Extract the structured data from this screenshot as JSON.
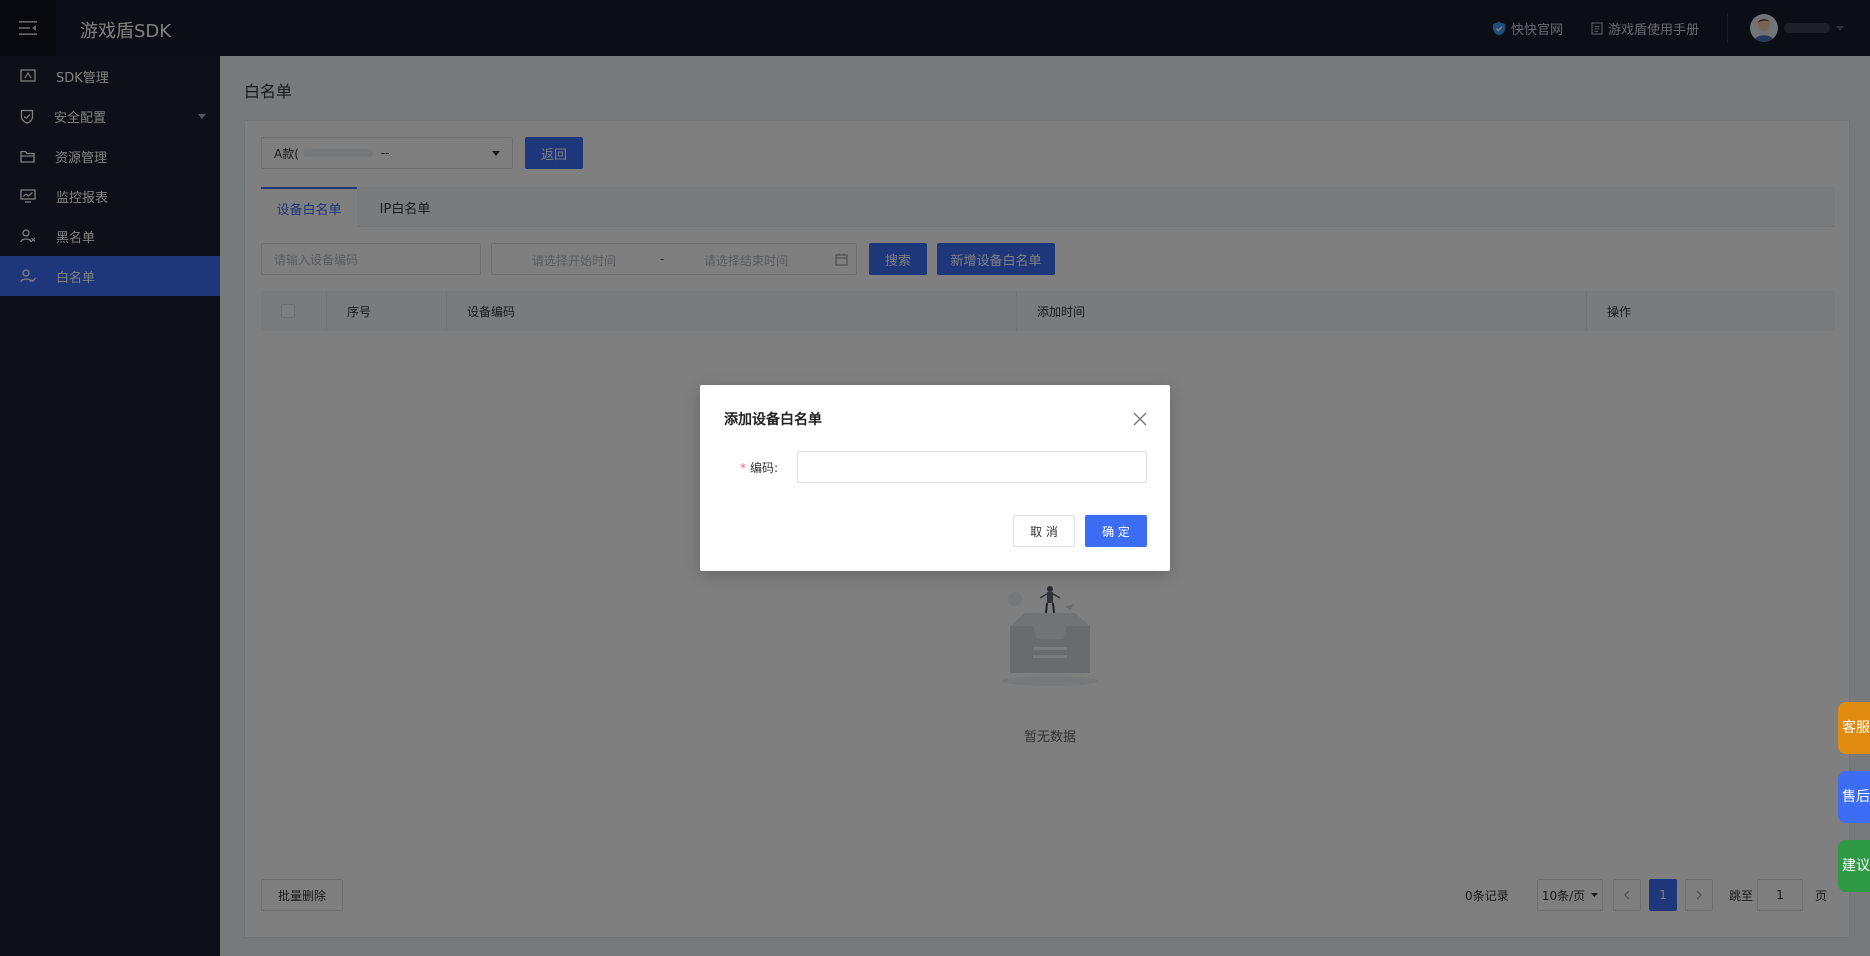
{
  "app": {
    "brand": "游戏盾SDK"
  },
  "topbar": {
    "link_official": "快快官网",
    "link_manual": "游戏盾使用手册"
  },
  "sidebar": {
    "items": [
      {
        "label": "SDK管理"
      },
      {
        "label": "安全配置"
      },
      {
        "label": "资源管理"
      },
      {
        "label": "监控报表"
      },
      {
        "label": "黑名单"
      },
      {
        "label": "白名单"
      }
    ]
  },
  "page": {
    "title": "白名单"
  },
  "toolbar": {
    "select_value_prefix": "A款(",
    "select_value_suffix": "--",
    "back_label": "返回"
  },
  "tabs": [
    {
      "label": "设备白名单"
    },
    {
      "label": "IP白名单"
    }
  ],
  "filters": {
    "device_placeholder": "请输入设备编码",
    "start_placeholder": "请选择开始时间",
    "separator": "-",
    "end_placeholder": "请选择结束时间",
    "search_label": "搜索",
    "add_label": "新增设备白名单"
  },
  "table": {
    "columns": [
      "序号",
      "设备编码",
      "添加时间",
      "操作"
    ],
    "empty_text": "暂无数据"
  },
  "footer": {
    "batch_delete_label": "批量删除",
    "total": "0条记录",
    "page_size": "10条/页",
    "current_page": "1",
    "jump_label": "跳至",
    "jump_value": "1",
    "page_unit": "页"
  },
  "float": {
    "service": "客服",
    "aftersale": "售后",
    "suggest": "建议"
  },
  "modal": {
    "title": "添加设备白名单",
    "required_mark": "*",
    "field_label": "编码:",
    "field_value": "",
    "cancel_label": "取 消",
    "ok_label": "确 定"
  },
  "colors": {
    "primary": "#3d6df5",
    "sidebar_bg": "#1d202e",
    "service": "#f39c12",
    "aftersale": "#3d6df5",
    "suggest": "#2ea043"
  }
}
